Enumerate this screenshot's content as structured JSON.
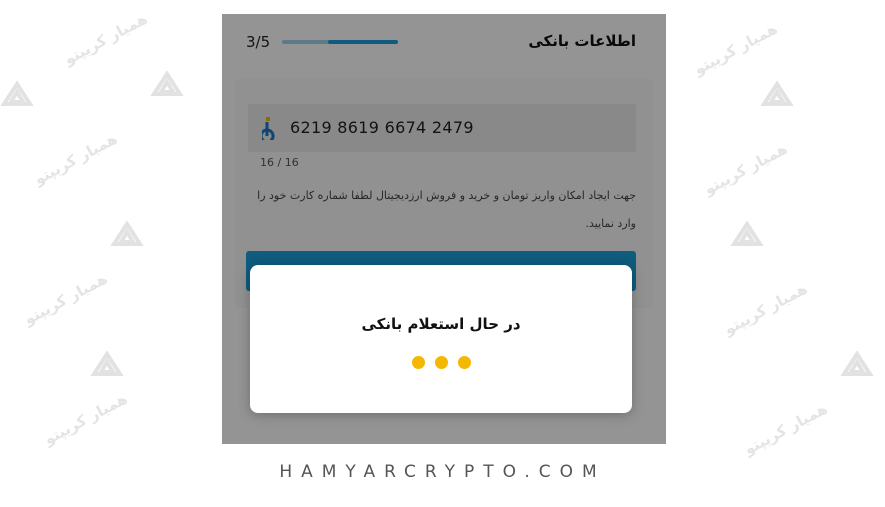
{
  "header": {
    "title": "اطلاعات بانکی",
    "step": "3/5",
    "progress_fraction": 0.6
  },
  "form": {
    "card_number": "6219 8619 6674 2479",
    "bank_icon": "blu-bank-logo-icon",
    "counter": "16 / 16",
    "note": "جهت ایجاد امکان واریز تومان و خرید و فروش ارزدیجیتال لطفا شماره کارت خود را وارد نمایید."
  },
  "dialog": {
    "title": "در حال استعلام بانکی",
    "loading_icon": "loading-dots-icon"
  },
  "footer": {
    "site": "HAMYARCRYPTO.COM"
  },
  "watermark": {
    "text": "همیار کریپتو",
    "logo_icon": "hamyarcrypto-logo-icon"
  },
  "colors": {
    "accent": "#1a9fd9",
    "dots": "#f5b800",
    "overlay": "rgba(0,0,0,0.42)"
  }
}
